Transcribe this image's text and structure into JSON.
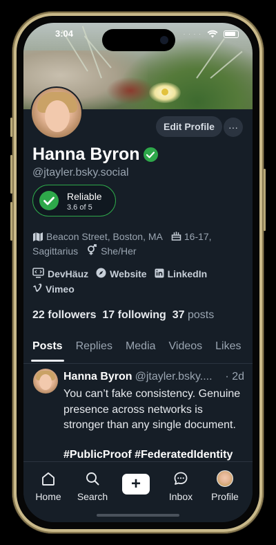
{
  "status_bar": {
    "time": "3:04",
    "dots": "· · · ·"
  },
  "profile": {
    "name": "Hanna Byron",
    "handle": "@jtayler.bsky.social",
    "edit_label": "Edit Profile",
    "more_label": "···",
    "reliability": {
      "title": "Reliable",
      "score": "3.6 of 5",
      "value": 3.6,
      "max": 5
    },
    "location": "Beacon Street, Boston, MA",
    "birthday": "16-17,",
    "zodiac": "Sagittarius",
    "pronouns": "She/Her",
    "links": [
      {
        "label": "DevHäuz",
        "icon": "monitor-icon"
      },
      {
        "label": "Website",
        "icon": "compass-icon"
      },
      {
        "label": "LinkedIn",
        "icon": "linkedin-icon"
      },
      {
        "label": "Vimeo",
        "icon": "vimeo-icon"
      }
    ],
    "followers_count": "22",
    "followers_label": "followers",
    "following_count": "17",
    "following_label": "following",
    "posts_count": "37",
    "posts_label": "posts"
  },
  "tabs": [
    "Posts",
    "Replies",
    "Media",
    "Videos",
    "Likes"
  ],
  "active_tab": "Posts",
  "post": {
    "author": "Hanna Byron",
    "handle": "@jtayler.bsky....",
    "time": "· 2d",
    "text": "You can’t fake consistency. Genuine presence across networks is stronger than any single document.",
    "tags": "#PublicProof #FederatedIdentity"
  },
  "bottom_nav": {
    "home": "Home",
    "search": "Search",
    "compose": "+",
    "inbox": "Inbox",
    "profile": "Profile"
  },
  "colors": {
    "background": "#161e27",
    "accent_green": "#2ea84a",
    "frame_gold": "#c9b98a",
    "muted_text": "#9aa5b1"
  }
}
